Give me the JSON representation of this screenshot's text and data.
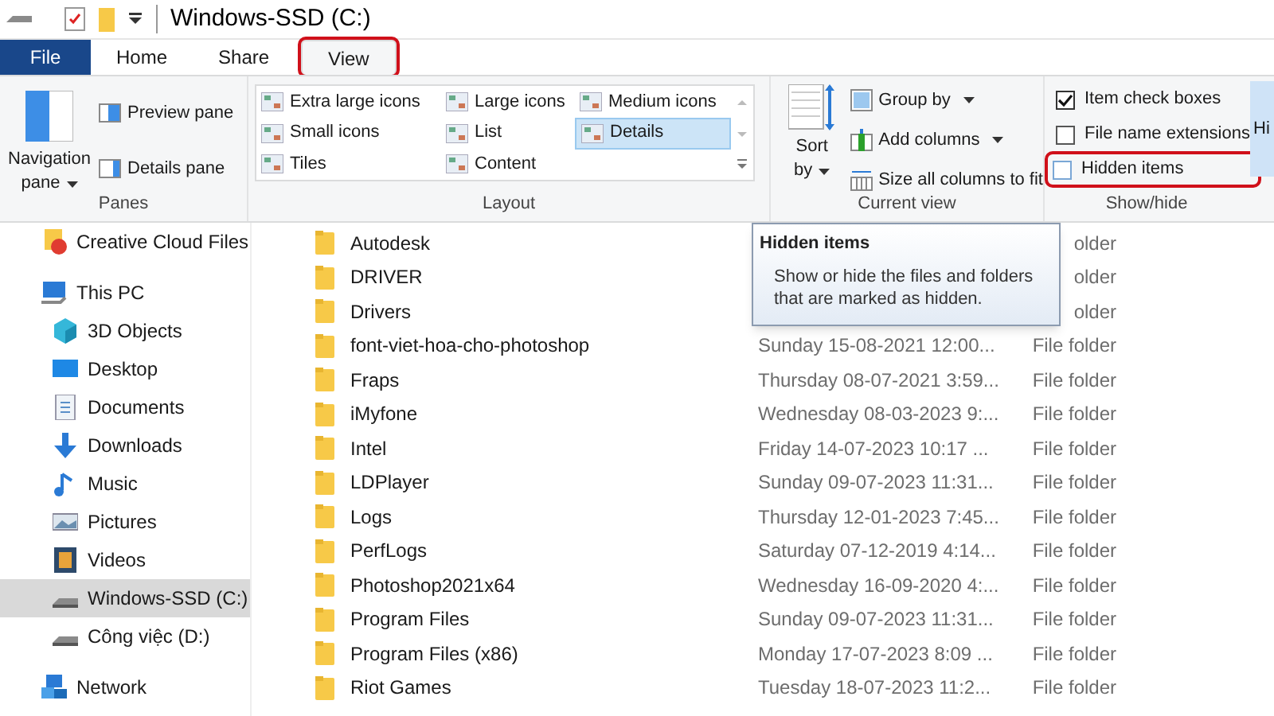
{
  "title_bar": {
    "title": "Windows-SSD (C:)"
  },
  "tabs": [
    {
      "label": "File",
      "kind": "file",
      "selected": false,
      "highlighted": false
    },
    {
      "label": "Home",
      "kind": "tab",
      "selected": false,
      "highlighted": false
    },
    {
      "label": "Share",
      "kind": "tab",
      "selected": false,
      "highlighted": false
    },
    {
      "label": "View",
      "kind": "tab",
      "selected": true,
      "highlighted": true
    }
  ],
  "ribbon": {
    "panes": {
      "label": "Panes",
      "navigation_pane": "Navigation pane",
      "items": [
        "Preview pane",
        "Details pane"
      ]
    },
    "layout": {
      "label": "Layout",
      "options": [
        {
          "label": "Extra large icons",
          "selected": false
        },
        {
          "label": "Small icons",
          "selected": false
        },
        {
          "label": "Tiles",
          "selected": false
        },
        {
          "label": "Large icons",
          "selected": false
        },
        {
          "label": "List",
          "selected": false
        },
        {
          "label": "Content",
          "selected": false
        },
        {
          "label": "Medium icons",
          "selected": false
        },
        {
          "label": "Details",
          "selected": true
        }
      ]
    },
    "current_view": {
      "label": "Current view",
      "sort_by": "Sort by",
      "items": [
        {
          "label": "Group by",
          "kind": "group",
          "dropdown": true
        },
        {
          "label": "Add columns",
          "kind": "columns",
          "dropdown": true
        },
        {
          "label": "Size all columns to fit",
          "kind": "fit",
          "dropdown": false
        }
      ]
    },
    "show_hide": {
      "label": "Show/hide",
      "options": [
        {
          "label": "Item check boxes",
          "checked": true,
          "highlighted": false
        },
        {
          "label": "File name extensions",
          "checked": false,
          "highlighted": false
        },
        {
          "label": "Hidden items",
          "checked": false,
          "highlighted": true
        }
      ],
      "cut_button": "Hi"
    }
  },
  "navigation": [
    {
      "label": "Creative Cloud Files",
      "kind": "cloud",
      "selected": false
    },
    {
      "label": "This PC",
      "kind": "pc",
      "selected": false,
      "children": [
        {
          "label": "3D Objects",
          "kind": "cube",
          "selected": false
        },
        {
          "label": "Desktop",
          "kind": "desktop",
          "selected": false
        },
        {
          "label": "Documents",
          "kind": "document",
          "selected": false
        },
        {
          "label": "Downloads",
          "kind": "download",
          "selected": false
        },
        {
          "label": "Music",
          "kind": "music",
          "selected": false
        },
        {
          "label": "Pictures",
          "kind": "pictures",
          "selected": false
        },
        {
          "label": "Videos",
          "kind": "video",
          "selected": false
        },
        {
          "label": "Windows-SSD (C:)",
          "kind": "drive",
          "selected": true
        },
        {
          "label": "Công việc (D:)",
          "kind": "drive",
          "selected": false
        }
      ]
    },
    {
      "label": "Network",
      "kind": "network",
      "selected": false
    }
  ],
  "files": [
    {
      "name": "Autodesk",
      "type": "older"
    },
    {
      "name": "DRIVER",
      "type": "older"
    },
    {
      "name": "Drivers",
      "type": "older"
    },
    {
      "name": "font-viet-hoa-cho-photoshop",
      "date_modified": "Sunday 15-08-2021 12:00...",
      "type": "File folder"
    },
    {
      "name": "Fraps",
      "date_modified": "Thursday 08-07-2021 3:59...",
      "type": "File folder"
    },
    {
      "name": "iMyfone",
      "date_modified": "Wednesday 08-03-2023 9:...",
      "type": "File folder"
    },
    {
      "name": "Intel",
      "date_modified": "Friday 14-07-2023 10:17 ...",
      "type": "File folder"
    },
    {
      "name": "LDPlayer",
      "date_modified": "Sunday 09-07-2023 11:31...",
      "type": "File folder"
    },
    {
      "name": "Logs",
      "date_modified": "Thursday 12-01-2023 7:45...",
      "type": "File folder"
    },
    {
      "name": "PerfLogs",
      "date_modified": "Saturday 07-12-2019 4:14...",
      "type": "File folder"
    },
    {
      "name": "Photoshop2021x64",
      "date_modified": "Wednesday 16-09-2020 4:...",
      "type": "File folder"
    },
    {
      "name": "Program Files",
      "date_modified": "Sunday 09-07-2023 11:31...",
      "type": "File folder"
    },
    {
      "name": "Program Files (x86)",
      "date_modified": "Monday 17-07-2023 8:09 ...",
      "type": "File folder"
    },
    {
      "name": "Riot Games",
      "date_modified": "Tuesday 18-07-2023 11:2...",
      "type": "File folder"
    }
  ],
  "tooltip": {
    "title": "Hidden items",
    "text": "Show or hide the files and folders that are marked as hidden."
  }
}
